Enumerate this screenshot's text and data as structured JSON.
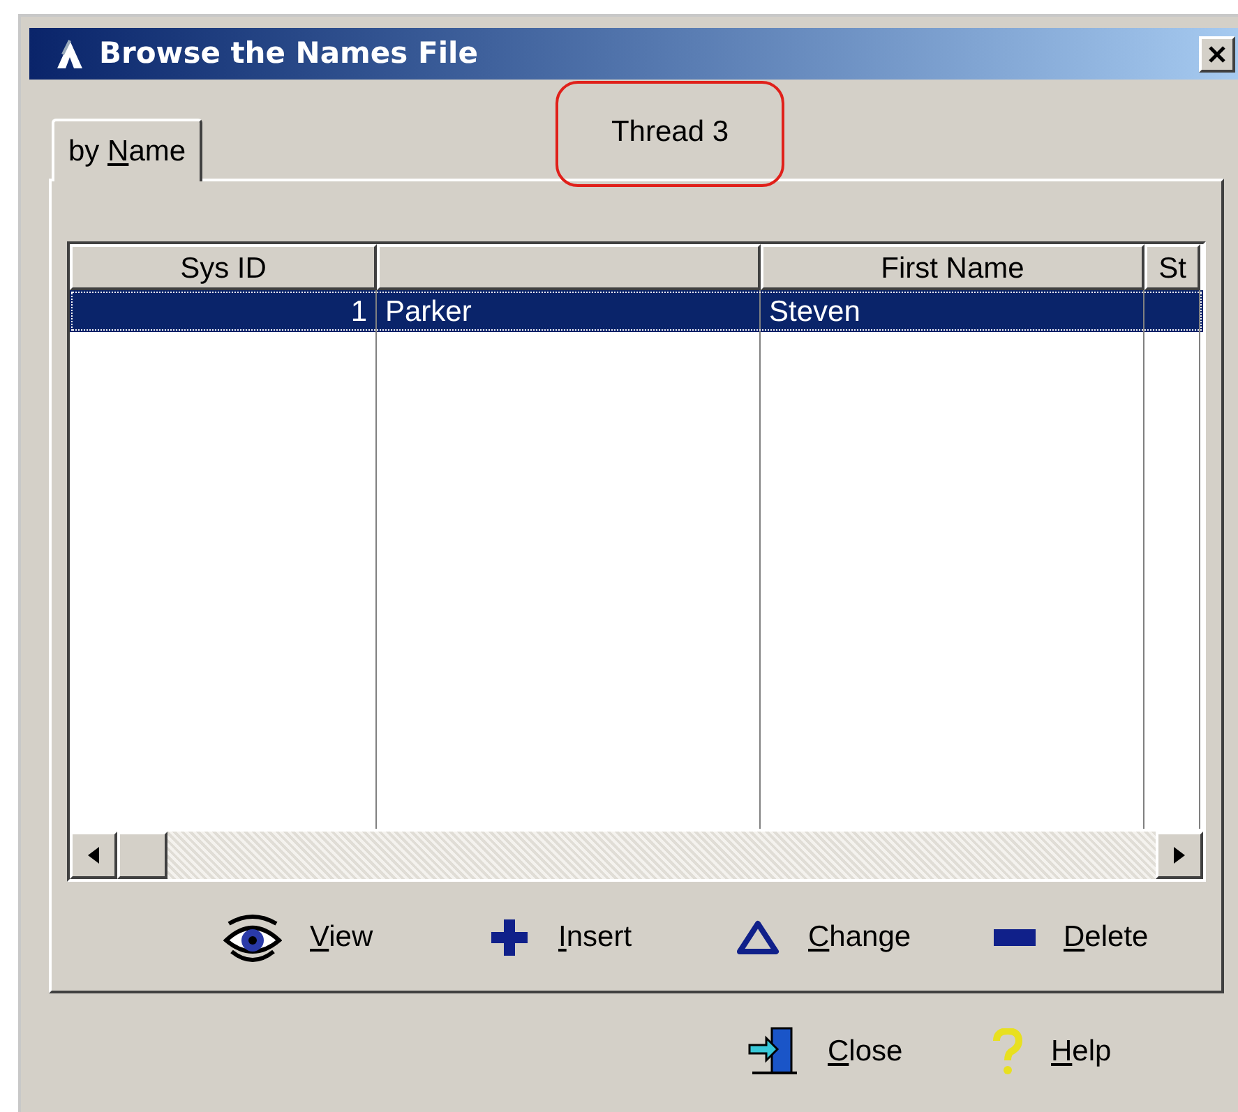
{
  "window": {
    "title": "Browse the Names File"
  },
  "tabs": [
    {
      "pre": "by ",
      "key": "N",
      "post": "ame",
      "selected": true
    }
  ],
  "annotation": {
    "text": "Thread 3"
  },
  "table": {
    "columns": [
      {
        "label": "Sys ID"
      },
      {},
      {
        "label": "First Name"
      },
      {
        "label": "St"
      }
    ],
    "rows": [
      {
        "cells": [
          "1",
          "Parker",
          "Steven"
        ],
        "selected": true
      }
    ]
  },
  "actions": [
    {
      "kind": "view",
      "key": "V",
      "post": "iew"
    },
    {
      "kind": "insert",
      "key": "I",
      "post": "nsert"
    },
    {
      "kind": "change",
      "key": "C",
      "post": "hange"
    },
    {
      "kind": "delete",
      "key": "D",
      "post": "elete"
    }
  ],
  "footer_buttons": [
    {
      "kind": "close",
      "key": "C",
      "post": "lose"
    },
    {
      "kind": "help",
      "key": "H",
      "post": "elp"
    }
  ]
}
